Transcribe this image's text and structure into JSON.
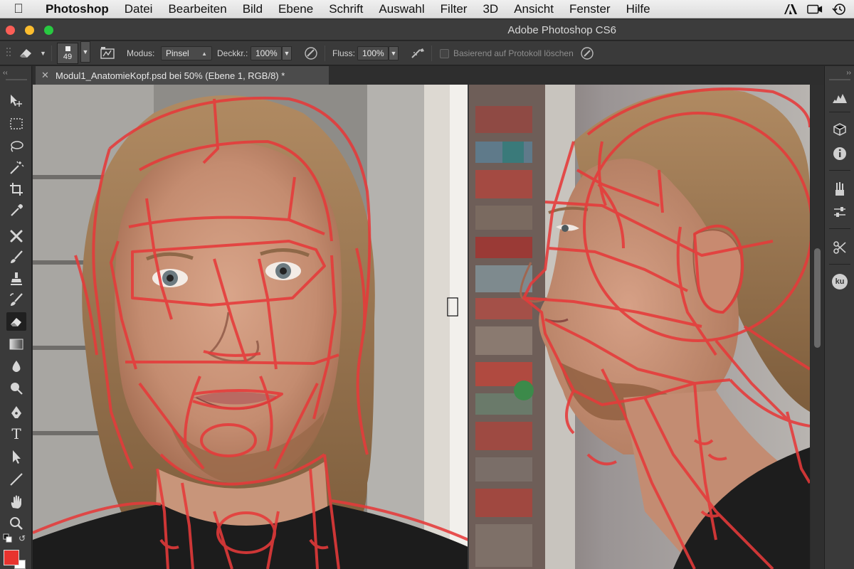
{
  "menubar": {
    "app": "Photoshop",
    "items": [
      "Datei",
      "Bearbeiten",
      "Bild",
      "Ebene",
      "Schrift",
      "Auswahl",
      "Filter",
      "3D",
      "Ansicht",
      "Fenster",
      "Hilfe"
    ],
    "right_icons": [
      "adobe-icon",
      "camera-icon",
      "time-machine-icon"
    ]
  },
  "window": {
    "title": "Adobe Photoshop CS6"
  },
  "options": {
    "brush_size": "49",
    "mode_label": "Modus:",
    "mode_value": "Pinsel",
    "opacity_label": "Deckkr.:",
    "opacity_value": "100%",
    "flow_label": "Fluss:",
    "flow_value": "100%",
    "history_label": "Basierend auf Protokoll löschen"
  },
  "document": {
    "tab_title": "Modul1_AnatomieKopf.psd bei 50% (Ebene 1, RGB/8) *"
  },
  "colors": {
    "foreground": "#e8332e",
    "background": "#ffffff",
    "overlay_lines": "#e63a3a"
  },
  "tools": [
    "move-tool",
    "marquee-tool",
    "lasso-tool",
    "magic-wand-tool",
    "crop-tool",
    "eyedropper-tool",
    "healing-tool",
    "brush-tool",
    "stamp-tool",
    "history-brush-tool",
    "eraser-tool",
    "gradient-tool",
    "blur-tool",
    "dodge-tool",
    "pen-tool",
    "type-tool",
    "path-selection-tool",
    "line-tool",
    "hand-tool",
    "zoom-tool"
  ],
  "type_tool_label": "T",
  "right_panels": [
    "histogram-icon",
    "3d-icon",
    "info-icon",
    "brush-presets-icon",
    "adjustments-icon",
    "tool-presets-icon",
    "ku-icon"
  ],
  "ku_label": "ku"
}
